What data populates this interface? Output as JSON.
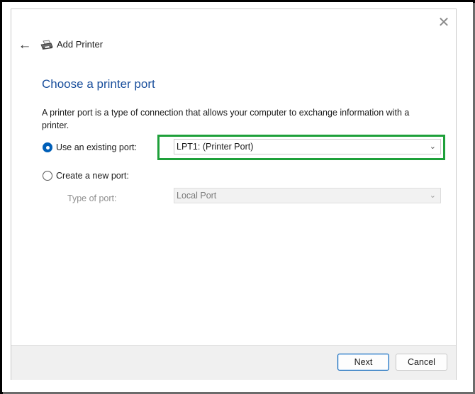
{
  "window": {
    "title": "Add Printer",
    "close_glyph": "✕",
    "back_glyph": "←",
    "icons": {
      "close": "close-icon",
      "back": "back-arrow-icon",
      "printer": "printer-icon"
    }
  },
  "content": {
    "heading": "Choose a printer port",
    "description": "A printer port is a type of connection that allows your computer to exchange information with a printer."
  },
  "options": {
    "use_existing": {
      "label": "Use an existing port:",
      "selected": true,
      "value": "LPT1: (Printer Port)"
    },
    "create_new": {
      "label": "Create a new port:",
      "selected": false,
      "type_label": "Type of port:",
      "value": "Local Port"
    }
  },
  "buttons": {
    "next": "Next",
    "cancel": "Cancel"
  },
  "colors": {
    "accent": "#005fb8",
    "heading": "#1a4f9c",
    "highlight": "#1ea03a"
  }
}
